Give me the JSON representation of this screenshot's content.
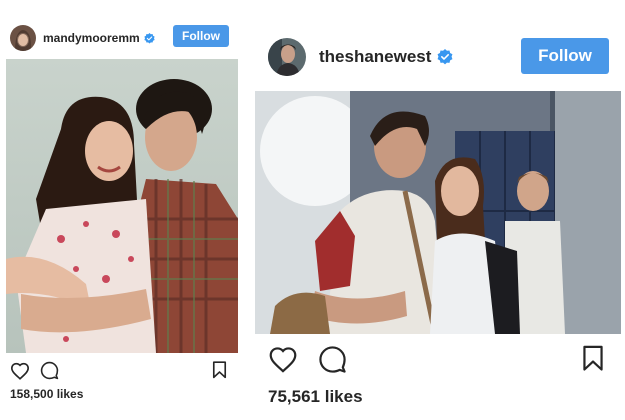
{
  "posts": [
    {
      "username": "mandymooremm",
      "verified": true,
      "follow_label": "Follow",
      "likes": "158,500 likes",
      "icons": {
        "verified": "verified-badge-icon",
        "like": "heart-icon",
        "comment": "comment-bubble-icon",
        "save": "bookmark-icon"
      }
    },
    {
      "username": "theshanewest",
      "verified": true,
      "follow_label": "Follow",
      "likes": "75,561 likes",
      "icons": {
        "verified": "verified-badge-icon",
        "like": "heart-icon",
        "comment": "comment-bubble-icon",
        "save": "bookmark-icon"
      }
    }
  ],
  "colors": {
    "follow_button": "#4a98e8",
    "verified_badge": "#3897f0",
    "text": "#262626"
  }
}
